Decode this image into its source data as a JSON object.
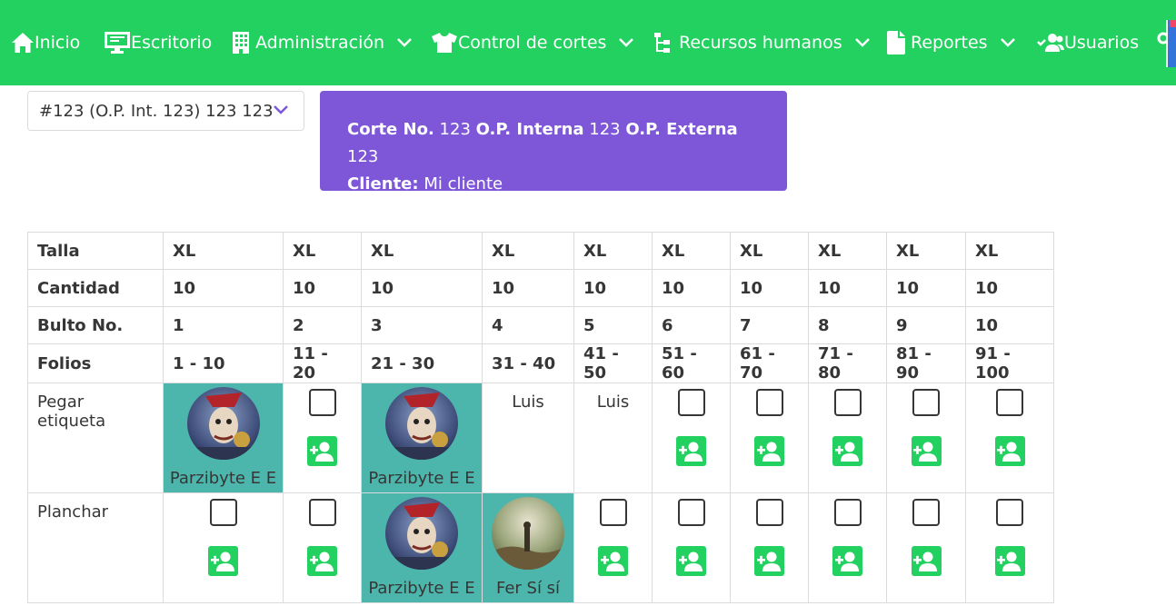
{
  "nav": {
    "inicio": "Inicio",
    "escritorio": "Escritorio",
    "administracion": "Administración",
    "control_cortes": "Control de cortes",
    "recursos_humanos": "Recursos humanos",
    "reportes": "Reportes",
    "usuarios": "Usuarios"
  },
  "select": {
    "value": "#123 (O.P. Int. 123) 123 123"
  },
  "info": {
    "corte_label": "Corte No.",
    "corte_value": "123",
    "op_interna_label": "O.P. Interna",
    "op_interna_value": "123",
    "op_externa_label": "O.P. Externa",
    "op_externa_value": "123",
    "cliente_label": "Cliente:",
    "cliente_value": "Mi cliente"
  },
  "table": {
    "rows": [
      {
        "label": "Talla",
        "values": [
          "XL",
          "XL",
          "XL",
          "XL",
          "XL",
          "XL",
          "XL",
          "XL",
          "XL",
          "XL"
        ]
      },
      {
        "label": "Cantidad",
        "values": [
          "10",
          "10",
          "10",
          "10",
          "10",
          "10",
          "10",
          "10",
          "10",
          "10"
        ]
      },
      {
        "label": "Bulto No.",
        "values": [
          "1",
          "2",
          "3",
          "4",
          "5",
          "6",
          "7",
          "8",
          "9",
          "10"
        ]
      },
      {
        "label": "Folios",
        "values": [
          "1 - 10",
          "11 - 20",
          "21 - 30",
          "31 - 40",
          "41 - 50",
          "51 - 60",
          "61 - 70",
          "71 - 80",
          "81 - 90",
          "91 - 100"
        ]
      }
    ],
    "actions": [
      {
        "label": "Pegar etiqueta",
        "cells": [
          {
            "type": "user",
            "name": "Parzibyte E E",
            "avatar": "parzibyte"
          },
          {
            "type": "empty"
          },
          {
            "type": "user",
            "name": "Parzibyte E E",
            "avatar": "parzibyte"
          },
          {
            "type": "text",
            "name": "Luis"
          },
          {
            "type": "text",
            "name": "Luis"
          },
          {
            "type": "empty"
          },
          {
            "type": "empty"
          },
          {
            "type": "empty"
          },
          {
            "type": "empty"
          },
          {
            "type": "empty"
          }
        ]
      },
      {
        "label": "Planchar",
        "cells": [
          {
            "type": "empty"
          },
          {
            "type": "empty"
          },
          {
            "type": "user",
            "name": "Parzibyte E E",
            "avatar": "parzibyte"
          },
          {
            "type": "user",
            "name": "Fer Sí sí",
            "avatar": "fer"
          },
          {
            "type": "empty"
          },
          {
            "type": "empty"
          },
          {
            "type": "empty"
          },
          {
            "type": "empty"
          },
          {
            "type": "empty"
          },
          {
            "type": "empty"
          }
        ]
      }
    ]
  },
  "colors": {
    "navbar": "#23d160",
    "info_box": "#7e57d8",
    "filled_cell": "#4db6ac",
    "add_button": "#23d160"
  },
  "icons": [
    "home-icon",
    "desktop-icon",
    "building-icon",
    "shirt-icon",
    "org-chart-icon",
    "file-icon",
    "users-icon",
    "chevron-down-icon",
    "checkbox-icon",
    "add-user-icon",
    "settings-icon"
  ]
}
